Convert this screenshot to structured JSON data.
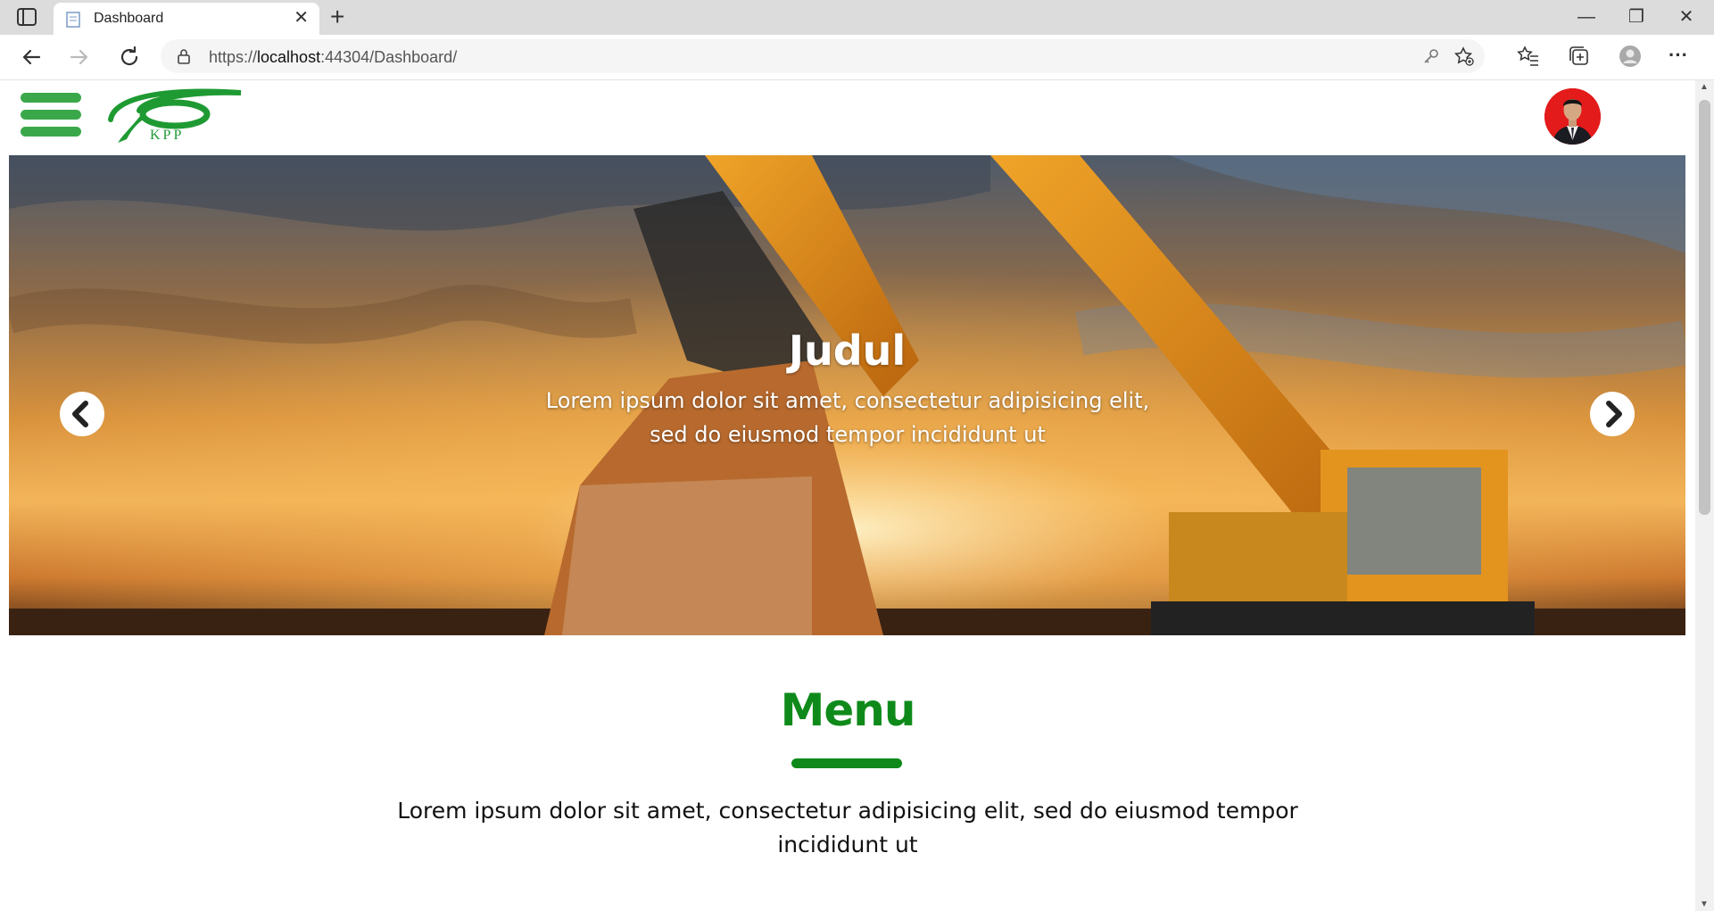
{
  "browser": {
    "tab_title": "Dashboard",
    "tab_close": "✕",
    "new_tab": "+",
    "window_controls": {
      "minimize": "—",
      "restore": "❐",
      "close": "✕"
    },
    "url_prefix": "https://",
    "url_host": "localhost",
    "url_rest": ":44304/Dashboard/",
    "nav_icons": [
      "back-icon",
      "forward-icon",
      "refresh-icon",
      "lock-icon",
      "key-icon",
      "add-favorite-icon",
      "favorites-icon",
      "collections-icon",
      "profile-icon",
      "more-icon"
    ],
    "more_label": "···"
  },
  "header": {
    "logo_text": "KPP",
    "brand_color": "#3aa84a"
  },
  "hero": {
    "title": "Judul",
    "text": "Lorem ipsum dolor sit amet, consectetur adipisicing elit, sed do eiusmod tempor incididunt ut",
    "prev_icon": "chevron-left-icon",
    "next_icon": "chevron-right-icon"
  },
  "menu": {
    "title": "Menu",
    "text": "Lorem ipsum dolor sit amet, consectetur adipisicing elit, sed do eiusmod tempor incididunt ut",
    "accent_color": "#0f8a1a"
  }
}
